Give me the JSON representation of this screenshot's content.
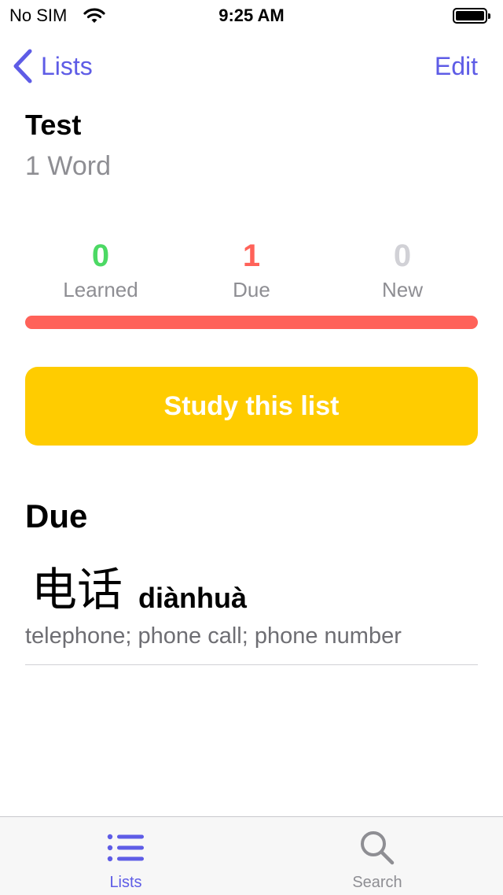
{
  "status_bar": {
    "carrier": "No SIM",
    "time": "9:25 AM"
  },
  "nav": {
    "back_label": "Lists",
    "edit_label": "Edit"
  },
  "list": {
    "title": "Test",
    "count_label": "1 Word"
  },
  "stats": [
    {
      "value": "0",
      "label": "Learned",
      "color": "#4cd964"
    },
    {
      "value": "1",
      "label": "Due",
      "color": "#ff6259"
    },
    {
      "value": "0",
      "label": "New",
      "color": "#d1d1d6"
    }
  ],
  "progress": {
    "learned_fraction": 0,
    "due_fraction": 1,
    "new_fraction": 0
  },
  "study_button": {
    "label": "Study this list"
  },
  "due_section": {
    "title": "Due",
    "words": [
      {
        "hanzi": "电话",
        "pinyin": "diànhuà",
        "definition": "telephone; phone call; phone number"
      }
    ]
  },
  "tabbar": {
    "tabs": [
      {
        "label": "Lists",
        "icon": "list-icon",
        "active": true
      },
      {
        "label": "Search",
        "icon": "search-icon",
        "active": false
      }
    ]
  },
  "colors": {
    "accent": "#5e5ce6",
    "study_button": "#ffcc00",
    "inactive_tab": "#8e8e93"
  }
}
